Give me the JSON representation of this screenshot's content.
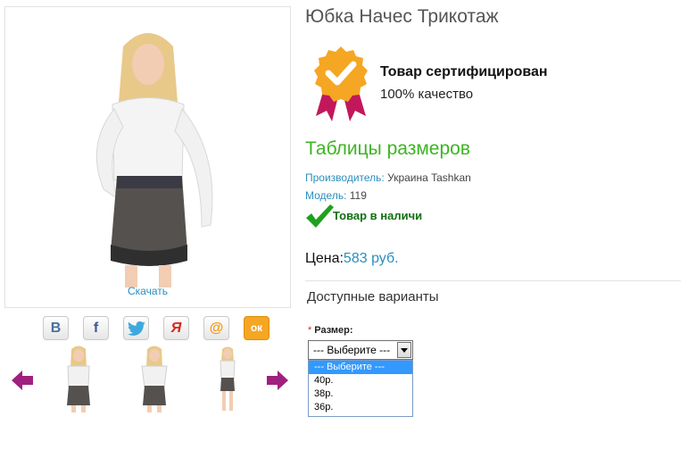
{
  "product": {
    "title": "Юбка Начес Трикотаж",
    "download_link": "Скачать"
  },
  "certificate": {
    "title": "Товар сертифицирован",
    "subtitle": "100% качество"
  },
  "size_tables_link": "Таблицы размеров",
  "manufacturer": {
    "label": "Производитель:",
    "value": "Украина Tashkan"
  },
  "model": {
    "label": "Модель:",
    "value": "119"
  },
  "stock_status": "Товар в наличи",
  "price": {
    "label": "Цена:",
    "value": "583 руб."
  },
  "variants_heading": "Доступные варианты",
  "size_field": {
    "required_mark": "*",
    "label": "Размер:",
    "selected": "--- Выберите ---",
    "options": [
      "--- Выберите ---",
      "40р.",
      "38р.",
      "36р."
    ]
  },
  "share": [
    {
      "name": "vkontakte",
      "glyph": "В"
    },
    {
      "name": "facebook",
      "glyph": "f"
    },
    {
      "name": "twitter",
      "glyph": ""
    },
    {
      "name": "yandex",
      "glyph": "Я"
    },
    {
      "name": "mail",
      "glyph": "@"
    },
    {
      "name": "odnoklassniki",
      "glyph": "ок"
    }
  ],
  "colors": {
    "accent_blue": "#2a8fbd",
    "green_heading": "#3cb521",
    "stock_green": "#107010",
    "nav_arrow": "#a0207f"
  }
}
